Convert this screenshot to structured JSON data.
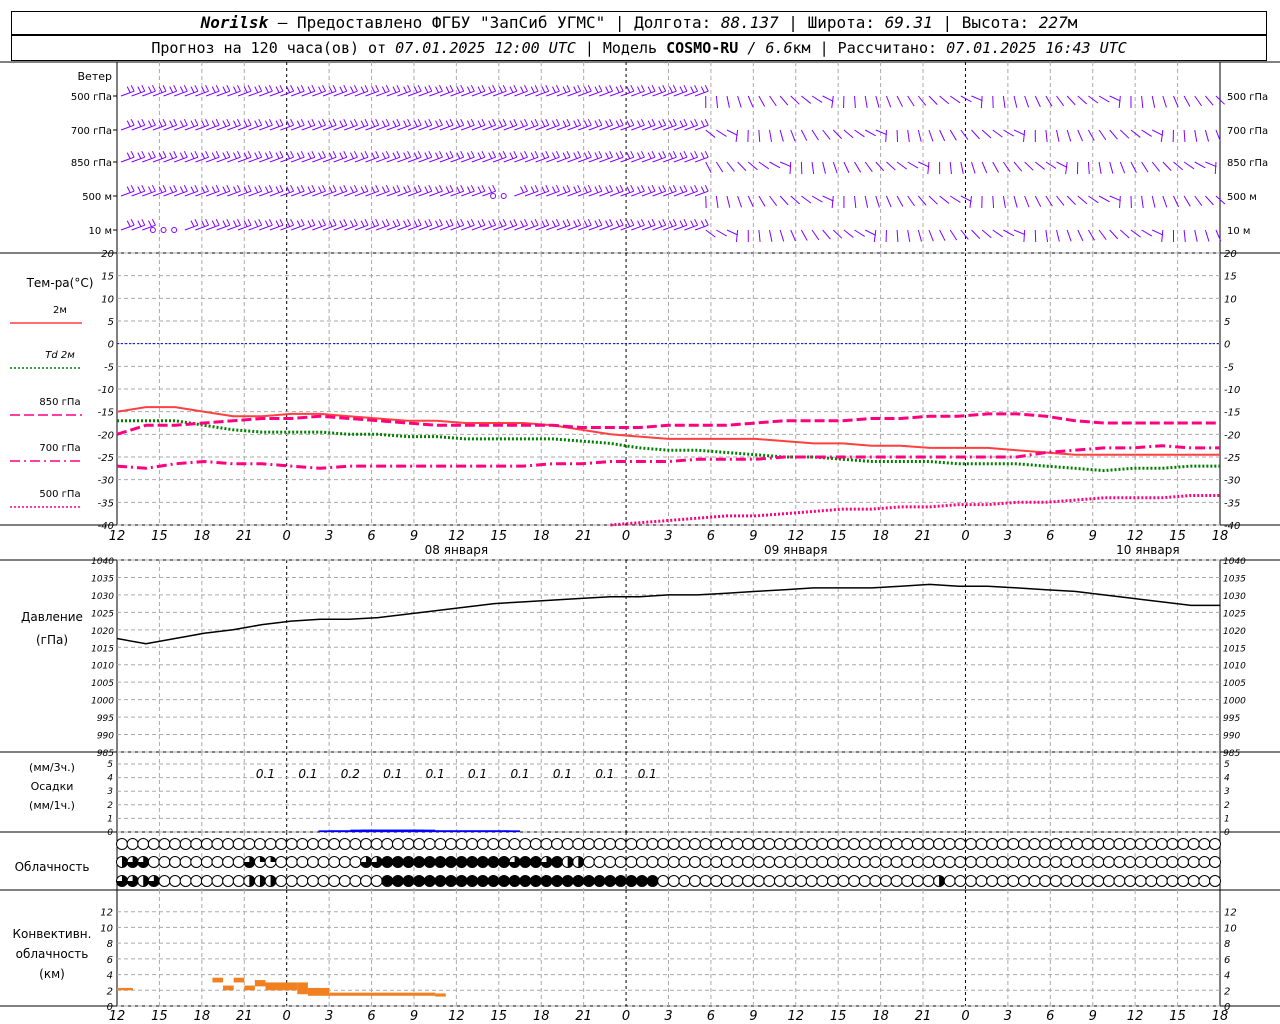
{
  "header": {
    "station": "Norilsk",
    "provider": "– Предоставлено ФГБУ \"ЗапСиб УГМС\" |",
    "lon_label": "Долгота:",
    "lon_value": "88.137",
    "lat_label": "| Широта:",
    "lat_value": "69.31",
    "alt_label": "| Высота:",
    "alt_value": "227",
    "alt_unit": "м",
    "forecast_label": "Прогноз на 120 часа(ов) от",
    "forecast_start": "07.01.2025 12:00 UTC",
    "model_label": "| Модель",
    "model_name": "COSMO-RU",
    "model_res": "/ 6.6",
    "model_res_unit": "км",
    "calc_label": "| Рассчитано:",
    "calc_time": "07.01.2025 16:43 UTC"
  },
  "labels": {
    "wind_title": "Ветер",
    "wind_levels": [
      "500 гПа",
      "700 гПа",
      "850 гПа",
      "500 м",
      "10  м"
    ],
    "temp_title": "Тем-ра(°C)",
    "temp_legend": [
      "2м",
      "Td  2м",
      "850 гПа",
      "700 гПа",
      "500 гПа"
    ],
    "pressure_title_1": "Давление",
    "pressure_title_2": "(гПа)",
    "precip_title_1": "(мм/3ч.)",
    "precip_title_2": "Осадки",
    "precip_title_3": "(мм/1ч.)",
    "cloud_title": "Облачность",
    "conv_title_1": "Конвективн.",
    "conv_title_2": "облачность",
    "conv_title_3": "(км)",
    "day_labels": [
      "08 января",
      "09 января",
      "10 января"
    ]
  },
  "chart_data": {
    "type": "line",
    "x_hours_labels": [
      "12",
      "15",
      "18",
      "21",
      "0",
      "3",
      "6",
      "9",
      "12",
      "15",
      "18",
      "21",
      "0",
      "3",
      "6",
      "9",
      "12",
      "15",
      "18",
      "21",
      "0",
      "3",
      "6",
      "9",
      "12",
      "15",
      "18"
    ],
    "temperature": {
      "ylim": [
        -40,
        20
      ],
      "ticks": [
        20,
        15,
        10,
        5,
        0,
        -5,
        -10,
        -15,
        -20,
        -25,
        -30,
        -35,
        -40
      ],
      "series": [
        {
          "name": "2м",
          "color": "#ff4040",
          "style": "solid",
          "values": [
            -15,
            -14,
            -14,
            -15,
            -16,
            -16,
            -15.5,
            -15.5,
            -16,
            -16.5,
            -17,
            -17,
            -17.5,
            -17.5,
            -17.5,
            -18,
            -19,
            -20,
            -20.5,
            -21,
            -21,
            -21,
            -21,
            -21.5,
            -22,
            -22,
            -22.5,
            -22.5,
            -23,
            -23,
            -23,
            -23.5,
            -24,
            -24.5,
            -24.5,
            -24.5,
            -24.5,
            -24.5,
            -24.5
          ]
        },
        {
          "name": "Td  2м",
          "color": "#008000",
          "style": "dotted",
          "values": [
            -17,
            -17,
            -17,
            -18,
            -19,
            -19.5,
            -19.5,
            -19.5,
            -20,
            -20,
            -20.5,
            -20.5,
            -21,
            -21,
            -21,
            -21,
            -21.5,
            -22,
            -23,
            -23.5,
            -23.5,
            -24,
            -24.5,
            -25,
            -25,
            -25.5,
            -26,
            -26,
            -26,
            -26.5,
            -26.5,
            -26.5,
            -27,
            -27.5,
            -28,
            -27.5,
            -27.5,
            -27,
            -27
          ]
        },
        {
          "name": "850 гПа",
          "color": "#ff0080",
          "style": "dashed",
          "values": [
            -20,
            -18,
            -18,
            -17.5,
            -17,
            -16.5,
            -16.5,
            -16,
            -16.5,
            -17,
            -17.5,
            -18,
            -18,
            -18,
            -18,
            -18,
            -18.5,
            -18.5,
            -18.5,
            -18,
            -18,
            -18,
            -17.5,
            -17,
            -17,
            -17,
            -16.5,
            -16.5,
            -16,
            -16,
            -15.5,
            -15.5,
            -16,
            -17,
            -17.5,
            -17.5,
            -17.5,
            -17.5,
            -17.5
          ]
        },
        {
          "name": "700 гПа",
          "color": "#ff0080",
          "style": "dashdot",
          "values": [
            -27,
            -27.5,
            -26.5,
            -26,
            -26.5,
            -26.5,
            -27,
            -27.5,
            -27,
            -27,
            -27,
            -27,
            -27,
            -27,
            -27,
            -26.5,
            -26.5,
            -26,
            -26,
            -26,
            -25.5,
            -25.5,
            -25.5,
            -25,
            -25,
            -25,
            -25,
            -25,
            -25,
            -25,
            -25,
            -25,
            -24,
            -23.5,
            -23,
            -23,
            -22.5,
            -23,
            -23
          ]
        },
        {
          "name": "500 гПа",
          "color": "#ff0080",
          "style": "dotted",
          "start_index": 17,
          "values": [
            -40,
            -39.5,
            -39,
            -38.5,
            -38,
            -38,
            -37.5,
            -37,
            -36.5,
            -36.5,
            -36,
            -36,
            -35.5,
            -35.5,
            -35,
            -35,
            -34.5,
            -34,
            -34,
            -34,
            -33.5,
            -33.5
          ]
        }
      ]
    },
    "pressure": {
      "ylim": [
        985,
        1040
      ],
      "ticks": [
        1040,
        1035,
        1030,
        1025,
        1020,
        1015,
        1010,
        1005,
        1000,
        995,
        990,
        985
      ],
      "values": [
        1017.5,
        1016,
        1017.5,
        1019,
        1020,
        1021.5,
        1022.5,
        1023,
        1023,
        1023.5,
        1024.5,
        1025.5,
        1026.5,
        1027.5,
        1028,
        1028.5,
        1029,
        1029.5,
        1029.5,
        1030,
        1030,
        1030.5,
        1031,
        1031.5,
        1032,
        1032,
        1032,
        1032.5,
        1033,
        1032.5,
        1032.5,
        1032,
        1031.5,
        1031,
        1030,
        1029,
        1028,
        1027,
        1027
      ]
    },
    "precipitation": {
      "ylim": [
        0,
        5
      ],
      "ticks": [
        5,
        4,
        3,
        2,
        1,
        0
      ],
      "labels_3h": [
        "0.1",
        "0.1",
        "0.2",
        "0.1",
        "0.1",
        "0.1",
        "0.1",
        "0.1",
        "0.1",
        "0.1"
      ],
      "bars_1h": [
        0,
        0,
        0,
        0,
        0,
        0,
        0,
        0.05,
        0.05,
        0.05,
        0.1,
        0.1,
        0.1,
        0.1,
        0.1,
        0.1,
        0.1,
        0.05,
        0.05,
        0.05,
        0.05,
        0.05,
        0.05,
        0.05,
        0.05,
        0
      ]
    },
    "cloud": {
      "rows": 3,
      "total": [
        0,
        0,
        0,
        0,
        0,
        0,
        0,
        0,
        0,
        0,
        0,
        0,
        0,
        0,
        0,
        0,
        0,
        0,
        0,
        0,
        0,
        0,
        0,
        0,
        0,
        0,
        0,
        0,
        0,
        0,
        0,
        0,
        0,
        0,
        0,
        0,
        0,
        0,
        0,
        0,
        0,
        0,
        0,
        0,
        0,
        0,
        0,
        0,
        0,
        0,
        0,
        0,
        0,
        0,
        0,
        0,
        0,
        0,
        0,
        0,
        0,
        0,
        0,
        0,
        0,
        0,
        0,
        0,
        0,
        0,
        0,
        0,
        0,
        0,
        0,
        0,
        0,
        0,
        0,
        0,
        0,
        0,
        0,
        0,
        0,
        0,
        0,
        0,
        0,
        0,
        0,
        0,
        0,
        0,
        0,
        0,
        0,
        0,
        0,
        0,
        0,
        0,
        0,
        0
      ],
      "middle": [
        2,
        3,
        3,
        0,
        0,
        0,
        0,
        0,
        0,
        0,
        0,
        0,
        3,
        1,
        1,
        0,
        0,
        0,
        0,
        0,
        0,
        0,
        0,
        3,
        3,
        4,
        4,
        4,
        4,
        4,
        4,
        4,
        4,
        4,
        4,
        4,
        4,
        3,
        4,
        4,
        3,
        4,
        2,
        2,
        0,
        0,
        0,
        0,
        0,
        0,
        0,
        0,
        0,
        0,
        0,
        0,
        0,
        0,
        0,
        0,
        0,
        0,
        0,
        0,
        0,
        0,
        0,
        0,
        0,
        0,
        0,
        0,
        0,
        0,
        0,
        0,
        0,
        0,
        0,
        0,
        0,
        0,
        0,
        0,
        0,
        0,
        0,
        0,
        0,
        0,
        0,
        0,
        0,
        0,
        0,
        0,
        0,
        0,
        0,
        0,
        0,
        0,
        0,
        0
      ],
      "low": [
        3,
        3,
        2,
        3,
        0,
        0,
        0,
        0,
        0,
        0,
        0,
        0,
        2,
        2,
        2,
        0,
        0,
        0,
        0,
        0,
        0,
        0,
        0,
        0,
        0,
        4,
        4,
        4,
        4,
        4,
        4,
        4,
        4,
        4,
        4,
        4,
        4,
        4,
        4,
        4,
        4,
        4,
        4,
        4,
        4,
        4,
        4,
        4,
        4,
        4,
        4,
        0,
        0,
        0,
        0,
        0,
        0,
        0,
        0,
        0,
        0,
        0,
        0,
        0,
        0,
        0,
        0,
        0,
        0,
        0,
        0,
        0,
        0,
        0,
        0,
        0,
        0,
        2,
        0,
        0,
        0,
        0,
        0,
        0,
        0,
        0,
        0,
        0,
        0,
        0,
        0,
        0,
        0,
        0,
        0,
        0,
        0,
        0,
        0,
        0,
        0,
        0,
        0,
        0
      ]
    },
    "convective_cloud": {
      "ylim": [
        0,
        14
      ],
      "ticks": [
        12,
        10,
        8,
        6,
        4,
        2,
        0
      ],
      "segments": [
        {
          "from_h": 0,
          "to_h": 1.5,
          "bottom": 2,
          "top": 2.3
        },
        {
          "from_h": 9,
          "to_h": 10,
          "bottom": 3,
          "top": 3.6
        },
        {
          "from_h": 10,
          "to_h": 11,
          "bottom": 2,
          "top": 2.6
        },
        {
          "from_h": 11,
          "to_h": 12,
          "bottom": 3,
          "top": 3.6
        },
        {
          "from_h": 12,
          "to_h": 13,
          "bottom": 2,
          "top": 2.6
        },
        {
          "from_h": 13,
          "to_h": 14,
          "bottom": 2.5,
          "top": 3.3
        },
        {
          "from_h": 14,
          "to_h": 17,
          "bottom": 2,
          "top": 3
        },
        {
          "from_h": 17,
          "to_h": 18,
          "bottom": 1.5,
          "top": 3
        },
        {
          "from_h": 18,
          "to_h": 20,
          "bottom": 1.3,
          "top": 2.3
        },
        {
          "from_h": 20,
          "to_h": 30,
          "bottom": 1.3,
          "top": 1.7
        },
        {
          "from_h": 30,
          "to_h": 31,
          "bottom": 1.2,
          "top": 1.6
        }
      ]
    },
    "wind": {
      "levels": 5,
      "calm_circles": [
        [
          4,
          3
        ],
        [
          4,
          4
        ],
        [
          4,
          5
        ],
        [
          3,
          35
        ],
        [
          3,
          36
        ]
      ]
    },
    "colors": {
      "wind": "#8000ff",
      "grid": "#aaaaaa",
      "pressure": "#000000",
      "precip": "#0000ff",
      "conv": "#f08020",
      "zero_line": "#0000ff"
    }
  }
}
